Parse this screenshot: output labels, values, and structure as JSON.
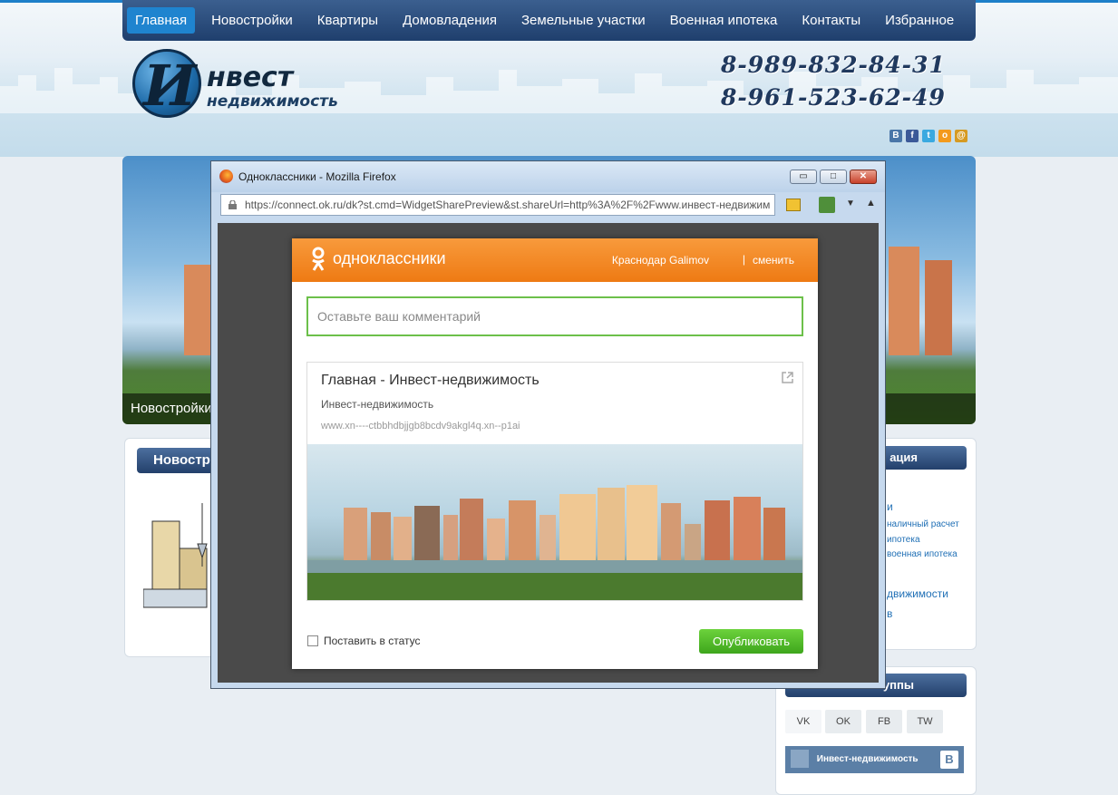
{
  "nav": {
    "items": [
      {
        "label": "Главная",
        "active": true
      },
      {
        "label": "Новостройки"
      },
      {
        "label": "Квартиры"
      },
      {
        "label": "Домовладения"
      },
      {
        "label": "Земельные участки"
      },
      {
        "label": "Военная ипотека"
      },
      {
        "label": "Контакты"
      },
      {
        "label": "Избранное"
      }
    ]
  },
  "logo": {
    "letter": "И",
    "line1": "нвест",
    "line2": "недвижимость"
  },
  "phones": [
    "8-989-832-84-31",
    "8-961-523-62-49"
  ],
  "social_icons": [
    "vk-icon",
    "facebook-icon",
    "twitter-icon",
    "odnoklassniki-icon",
    "mail-icon"
  ],
  "social_letters": [
    "В",
    "f",
    "t",
    "о",
    "@"
  ],
  "banner": {
    "caption": "Новостройки"
  },
  "content": {
    "block_title": "Новостр"
  },
  "right": {
    "box1_title": "ация",
    "links": [
      "и",
      "наличный расчет",
      "ипотека",
      "военная ипотека",
      "движимости",
      "в"
    ],
    "box2_title": "уппы",
    "tabs": [
      {
        "label": "VK"
      },
      {
        "label": "OK"
      },
      {
        "label": "FB"
      },
      {
        "label": "TW"
      }
    ],
    "vk_widget_label": "Инвест-недвижимость",
    "vk_badge": "B"
  },
  "firefox": {
    "title": "Одноклассники - Mozilla Firefox",
    "url": "https://connect.ok.ru/dk?st.cmd=WidgetSharePreview&st.shareUrl=http%3A%2F%2Fwww.инвест-недвижим",
    "buttons": {
      "minimize": "▭",
      "maximize": "□",
      "close": "✕"
    }
  },
  "ok_dialog": {
    "brand": "одноклассники",
    "user": "Краснодар Galimov",
    "separator": "|",
    "change": "сменить",
    "comment_placeholder": "Оставьте ваш комментарий",
    "card_title": "Главная - Инвест-недвижимость",
    "card_subtitle": "Инвест-недвижимость",
    "card_url": "www.xn----ctbbhdbjjgb8bcdv9akgl4q.xn--p1ai",
    "status_label": "Поставить в статус",
    "publish": "Опубликовать"
  },
  "colors": {
    "nav_active": "#1f84cf",
    "ok_orange": "#ee7a13",
    "publish_green": "#3ea61c",
    "comment_border": "#6cc04a"
  }
}
